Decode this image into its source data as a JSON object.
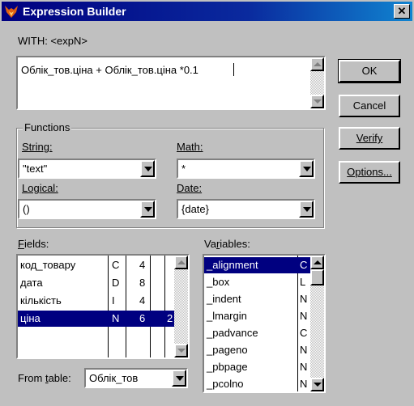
{
  "window": {
    "title": "Expression Builder",
    "close_label": "✕"
  },
  "expression": {
    "label": "WITH: <expN>",
    "value": "Облік_тов.ціна + Облік_тов.ціна *0.1"
  },
  "buttons": {
    "ok": "OK",
    "cancel": "Cancel",
    "verify": "Verify",
    "options": "Options..."
  },
  "functions": {
    "group_label": "Functions",
    "string": {
      "label": "String:",
      "value": "\"text\""
    },
    "math": {
      "label": "Math:",
      "value": "*"
    },
    "logical": {
      "label": "Logical:",
      "value": "()"
    },
    "date": {
      "label": "Date:",
      "value": "{date}"
    }
  },
  "fields": {
    "label": "Fields:",
    "rows": [
      {
        "name": "код_товару",
        "type": "C",
        "width": "4",
        "dec": ""
      },
      {
        "name": "дата",
        "type": "D",
        "width": "8",
        "dec": ""
      },
      {
        "name": "кількість",
        "type": "I",
        "width": "4",
        "dec": ""
      },
      {
        "name": "ціна",
        "type": "N",
        "width": "6",
        "dec": "2"
      }
    ],
    "selected_index": 3
  },
  "from_table": {
    "label": "From table:",
    "value": "Облік_тов"
  },
  "variables": {
    "label": "Variables:",
    "rows": [
      {
        "name": "_alignment",
        "type": "C"
      },
      {
        "name": "_box",
        "type": "L"
      },
      {
        "name": "_indent",
        "type": "N"
      },
      {
        "name": "_lmargin",
        "type": "N"
      },
      {
        "name": "_padvance",
        "type": "C"
      },
      {
        "name": "_pageno",
        "type": "N"
      },
      {
        "name": "_pbpage",
        "type": "N"
      },
      {
        "name": "_pcolno",
        "type": "N"
      }
    ],
    "selected_index": 0
  },
  "icons": [
    "fox-app-icon",
    "close-icon",
    "chevron-down-icon",
    "scroll-up-icon",
    "scroll-down-icon"
  ]
}
